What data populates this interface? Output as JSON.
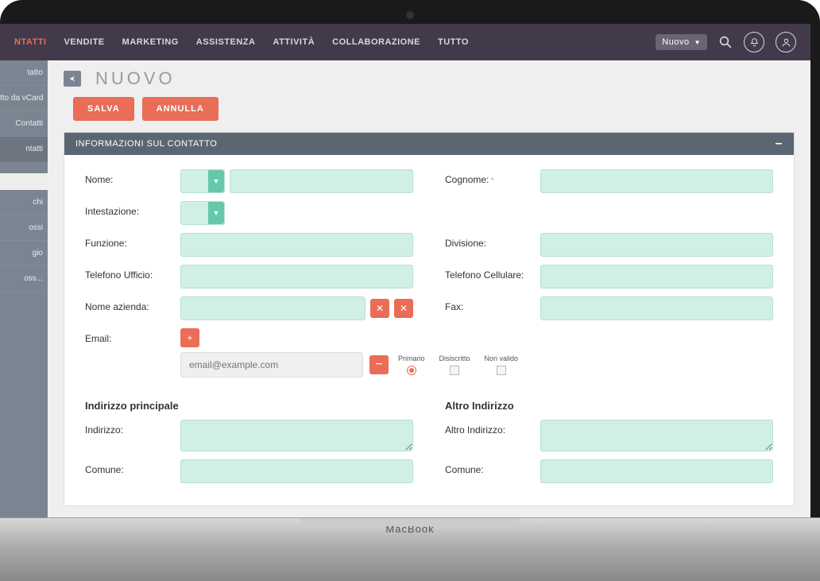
{
  "nav": {
    "tabs": [
      "NTATTI",
      "VENDITE",
      "MARKETING",
      "ASSISTENZA",
      "ATTIVITÀ",
      "COLLABORAZIONE",
      "TUTTO"
    ],
    "active_index": 0,
    "nuovo": "Nuovo"
  },
  "sidebar": {
    "items": [
      "tatto",
      "tto da vCard",
      "Contatti",
      "ntatti"
    ],
    "recent": [
      "",
      "chi",
      "ossi",
      "gio",
      "oss..."
    ]
  },
  "page": {
    "title": "NUOVO",
    "save": "SALVA",
    "cancel": "ANNULLA"
  },
  "panel": {
    "title": "INFORMAZIONI SUL CONTATTO"
  },
  "form": {
    "nome": "Nome:",
    "cognome": "Cognome:",
    "intestazione": "Intestazione:",
    "funzione": "Funzione:",
    "divisione": "Divisione:",
    "tel_ufficio": "Telefono Ufficio:",
    "tel_cell": "Telefono Cellulare:",
    "nome_azienda": "Nome azienda:",
    "fax": "Fax:",
    "email": "Email:",
    "email_placeholder": "email@example.com",
    "opt_primario": "Primario",
    "opt_disiscritto": "Disiscritto",
    "opt_nonvalido": "Non valido",
    "addr_main_h": "Indirizzo principale",
    "addr_alt_h": "Altro Indirizzo",
    "indirizzo": "Indirizzo:",
    "altro_indirizzo": "Altro Indirizzo:",
    "comune": "Comune:"
  },
  "device": {
    "logo": "MacBook"
  }
}
